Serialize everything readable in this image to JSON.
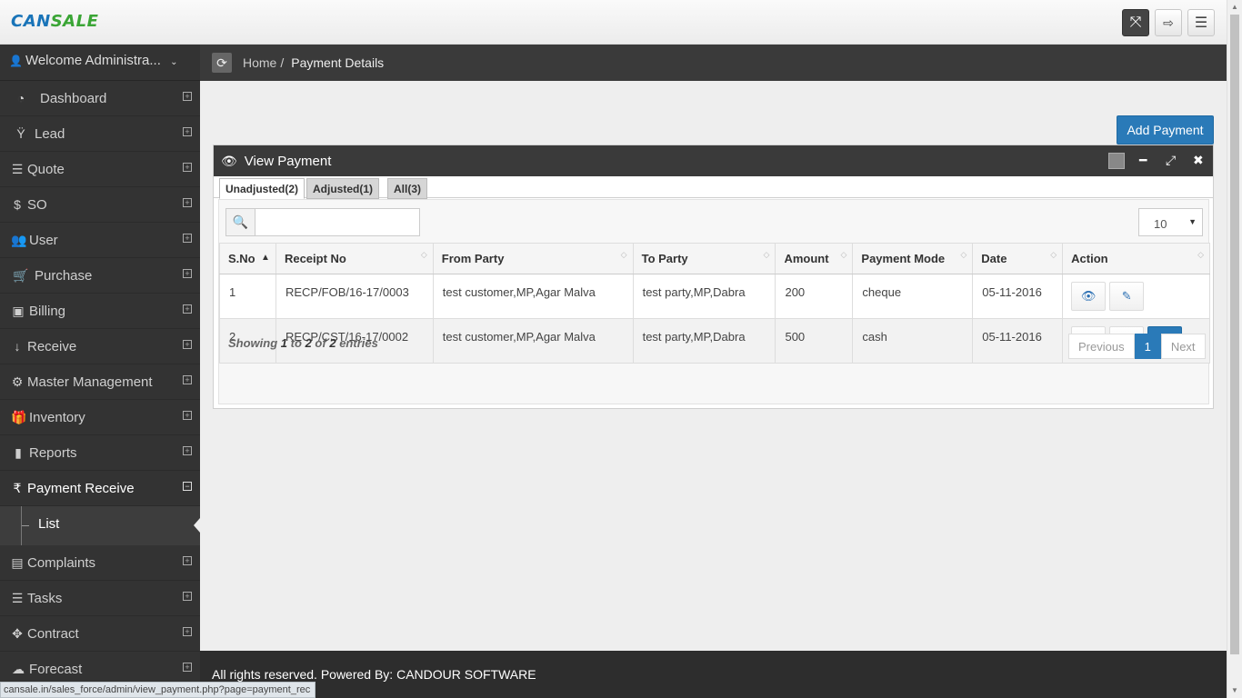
{
  "logo": {
    "part1": "CAN",
    "part2": "SALE"
  },
  "header": {
    "icons": [
      "fullscreen-icon",
      "logout-icon",
      "menu-icon"
    ]
  },
  "sidebar": {
    "welcome": "Welcome Administra...",
    "items": [
      {
        "label": "Dashboard",
        "icon": "dashboard-icon"
      },
      {
        "label": "Lead",
        "icon": "lead-icon"
      },
      {
        "label": "Quote",
        "icon": "quote-icon"
      },
      {
        "label": "SO",
        "icon": "dollar-icon"
      },
      {
        "label": "User",
        "icon": "users-icon"
      },
      {
        "label": "Purchase",
        "icon": "cart-icon"
      },
      {
        "label": "Billing",
        "icon": "money-icon"
      },
      {
        "label": "Receive",
        "icon": "download-icon"
      },
      {
        "label": "Master Management",
        "icon": "gear-icon"
      },
      {
        "label": "Inventory",
        "icon": "gift-icon"
      },
      {
        "label": "Reports",
        "icon": "book-icon"
      },
      {
        "label": "Payment Receive",
        "icon": "rupee-icon"
      }
    ],
    "subitem": "List",
    "items_after": [
      {
        "label": "Complaints",
        "icon": "list-icon"
      },
      {
        "label": "Tasks",
        "icon": "tasks-icon"
      },
      {
        "label": "Contract",
        "icon": "contract-icon"
      },
      {
        "label": "Forecast",
        "icon": "cloud-icon"
      }
    ]
  },
  "breadcrumb": {
    "home": "Home",
    "separator": "/",
    "current": "Payment Details"
  },
  "main": {
    "add_button": "Add Payment",
    "panel_title": "View Payment",
    "tabs": [
      "Unadjusted(2)",
      "Adjusted(1)",
      "All(3)"
    ],
    "search": {
      "value": "",
      "placeholder": ""
    },
    "page_length": "10",
    "columns": [
      "S.No",
      "Receipt No",
      "From Party",
      "To Party",
      "Amount",
      "Payment Mode",
      "Date",
      "Action"
    ],
    "rows": [
      {
        "sno": "1",
        "receipt": "RECP/FOB/16-17/0003",
        "from": "test customer,MP,Agar Malva",
        "to": "test party,MP,Dabra",
        "amount": "200",
        "mode": "cheque",
        "date": "05-11-2016"
      },
      {
        "sno": "2",
        "receipt": "RECP/CST/16-17/0002",
        "from": "test customer,MP,Agar Malva",
        "to": "test party,MP,Dabra",
        "amount": "500",
        "mode": "cash",
        "date": "05-11-2016"
      }
    ],
    "showing": {
      "prefix": "Showing",
      "from": "1",
      "to_word": "to",
      "to": "2",
      "of_word": "of",
      "total": "2",
      "suffix": "entries"
    },
    "pager": {
      "previous": "Previous",
      "current": "1",
      "next": "Next"
    }
  },
  "footer": {
    "text": "All rights reserved. Powered By: CANDOUR SOFTWARE"
  },
  "status_url": "cansale.in/sales_force/admin/view_payment.php?page=payment_rec"
}
